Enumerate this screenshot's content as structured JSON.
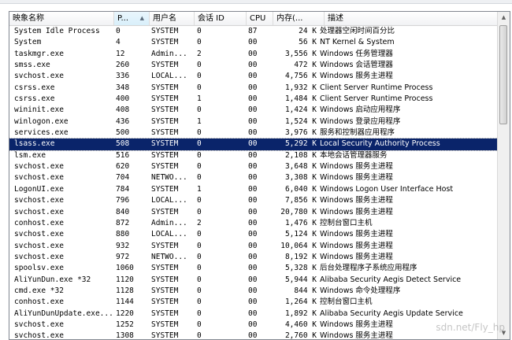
{
  "columns": {
    "name": "映象名称",
    "pid": "P...",
    "user": "用户名",
    "session": "会话 ID",
    "cpu": "CPU",
    "memory": "内存(...",
    "description": "描述"
  },
  "sort_indicator": "▲",
  "selected_row": 12,
  "rows": [
    {
      "name": "System Idle Process",
      "pid": "0",
      "user": "SYSTEM",
      "session": "0",
      "cpu": "87",
      "memory": "24 K",
      "description": "处理器空闲时间百分比"
    },
    {
      "name": "System",
      "pid": "4",
      "user": "SYSTEM",
      "session": "0",
      "cpu": "00",
      "memory": "56 K",
      "description": "NT Kernel & System"
    },
    {
      "name": "taskmgr.exe",
      "pid": "12",
      "user": "Admin...",
      "session": "2",
      "cpu": "00",
      "memory": "3,556 K",
      "description": "Windows 任务管理器"
    },
    {
      "name": "smss.exe",
      "pid": "260",
      "user": "SYSTEM",
      "session": "0",
      "cpu": "00",
      "memory": "472 K",
      "description": "Windows 会话管理器"
    },
    {
      "name": "svchost.exe",
      "pid": "336",
      "user": "LOCAL...",
      "session": "0",
      "cpu": "00",
      "memory": "4,756 K",
      "description": "Windows 服务主进程"
    },
    {
      "name": "csrss.exe",
      "pid": "348",
      "user": "SYSTEM",
      "session": "0",
      "cpu": "00",
      "memory": "1,932 K",
      "description": "Client Server Runtime Process"
    },
    {
      "name": "csrss.exe",
      "pid": "400",
      "user": "SYSTEM",
      "session": "1",
      "cpu": "00",
      "memory": "1,484 K",
      "description": "Client Server Runtime Process"
    },
    {
      "name": "wininit.exe",
      "pid": "408",
      "user": "SYSTEM",
      "session": "0",
      "cpu": "00",
      "memory": "1,424 K",
      "description": "Windows 启动应用程序"
    },
    {
      "name": "winlogon.exe",
      "pid": "436",
      "user": "SYSTEM",
      "session": "1",
      "cpu": "00",
      "memory": "1,524 K",
      "description": "Windows 登录应用程序"
    },
    {
      "name": "services.exe",
      "pid": "500",
      "user": "SYSTEM",
      "session": "0",
      "cpu": "00",
      "memory": "3,976 K",
      "description": "服务和控制器应用程序"
    },
    {
      "name": "lsass.exe",
      "pid": "508",
      "user": "SYSTEM",
      "session": "0",
      "cpu": "00",
      "memory": "5,292 K",
      "description": "Local Security Authority Process"
    },
    {
      "name": "lsm.exe",
      "pid": "516",
      "user": "SYSTEM",
      "session": "0",
      "cpu": "00",
      "memory": "2,108 K",
      "description": "本地会话管理器服务"
    },
    {
      "name": "svchost.exe",
      "pid": "620",
      "user": "SYSTEM",
      "session": "0",
      "cpu": "00",
      "memory": "3,648 K",
      "description": "Windows 服务主进程"
    },
    {
      "name": "svchost.exe",
      "pid": "704",
      "user": "NETWO...",
      "session": "0",
      "cpu": "00",
      "memory": "3,308 K",
      "description": "Windows 服务主进程"
    },
    {
      "name": "LogonUI.exe",
      "pid": "784",
      "user": "SYSTEM",
      "session": "1",
      "cpu": "00",
      "memory": "6,040 K",
      "description": "Windows Logon User Interface Host"
    },
    {
      "name": "svchost.exe",
      "pid": "796",
      "user": "LOCAL...",
      "session": "0",
      "cpu": "00",
      "memory": "7,856 K",
      "description": "Windows 服务主进程"
    },
    {
      "name": "svchost.exe",
      "pid": "840",
      "user": "SYSTEM",
      "session": "0",
      "cpu": "00",
      "memory": "20,780 K",
      "description": "Windows 服务主进程"
    },
    {
      "name": "conhost.exe",
      "pid": "872",
      "user": "Admin...",
      "session": "2",
      "cpu": "00",
      "memory": "1,476 K",
      "description": "控制台窗口主机"
    },
    {
      "name": "svchost.exe",
      "pid": "880",
      "user": "LOCAL...",
      "session": "0",
      "cpu": "00",
      "memory": "5,124 K",
      "description": "Windows 服务主进程"
    },
    {
      "name": "svchost.exe",
      "pid": "932",
      "user": "SYSTEM",
      "session": "0",
      "cpu": "00",
      "memory": "10,064 K",
      "description": "Windows 服务主进程"
    },
    {
      "name": "svchost.exe",
      "pid": "972",
      "user": "NETWO...",
      "session": "0",
      "cpu": "00",
      "memory": "8,192 K",
      "description": "Windows 服务主进程"
    },
    {
      "name": "spoolsv.exe",
      "pid": "1060",
      "user": "SYSTEM",
      "session": "0",
      "cpu": "00",
      "memory": "5,328 K",
      "description": "后台处理程序子系统应用程序"
    },
    {
      "name": "AliYunDun.exe *32",
      "pid": "1120",
      "user": "SYSTEM",
      "session": "0",
      "cpu": "00",
      "memory": "5,944 K",
      "description": "Alibaba Security Aegis Detect Service"
    },
    {
      "name": "cmd.exe *32",
      "pid": "1128",
      "user": "SYSTEM",
      "session": "0",
      "cpu": "00",
      "memory": "844 K",
      "description": "Windows 命令处理程序"
    },
    {
      "name": "conhost.exe",
      "pid": "1144",
      "user": "SYSTEM",
      "session": "0",
      "cpu": "00",
      "memory": "1,264 K",
      "description": "控制台窗口主机"
    },
    {
      "name": "AliYunDunUpdate.exe...",
      "pid": "1220",
      "user": "SYSTEM",
      "session": "0",
      "cpu": "00",
      "memory": "1,892 K",
      "description": "Alibaba Security Aegis Update Service"
    },
    {
      "name": "svchost.exe",
      "pid": "1252",
      "user": "SYSTEM",
      "session": "0",
      "cpu": "00",
      "memory": "4,460 K",
      "description": "Windows 服务主进程"
    },
    {
      "name": "svchost.exe",
      "pid": "1308",
      "user": "SYSTEM",
      "session": "0",
      "cpu": "00",
      "memory": "2,760 K",
      "description": "Windows 服务主进程"
    }
  ],
  "watermark": "sdn.net/Fly_hp"
}
